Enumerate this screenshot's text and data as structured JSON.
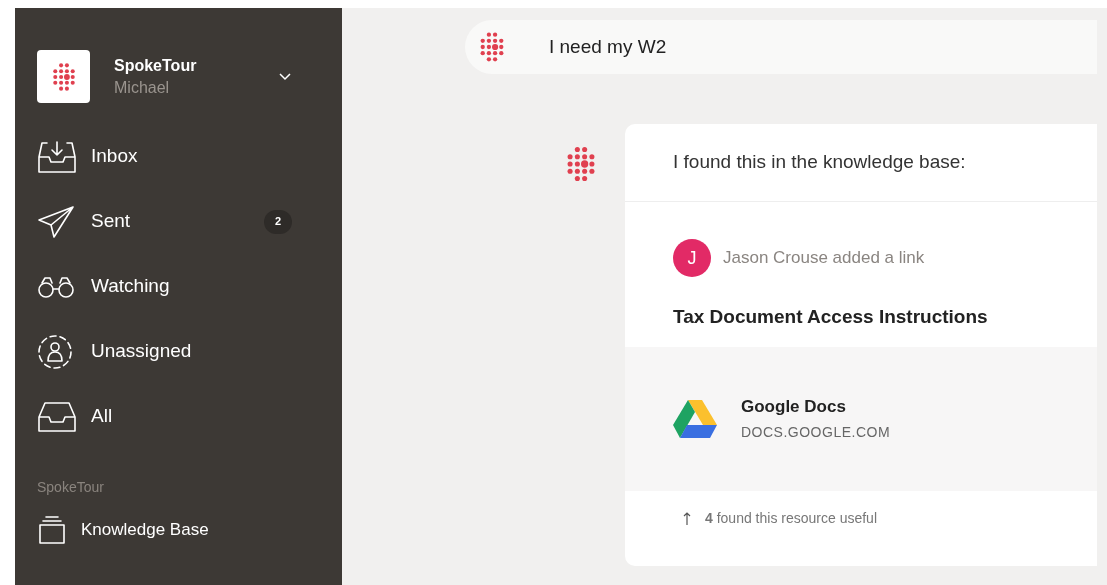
{
  "workspace": {
    "name": "SpokeTour",
    "user": "Michael"
  },
  "nav": [
    {
      "label": "Inbox",
      "kind": "inbox"
    },
    {
      "label": "Sent",
      "kind": "sent",
      "badge": "2"
    },
    {
      "label": "Watching",
      "kind": "watching"
    },
    {
      "label": "Unassigned",
      "kind": "unassigned"
    },
    {
      "label": "All",
      "kind": "all"
    }
  ],
  "section": {
    "title": "SpokeTour",
    "items": [
      {
        "label": "Knowledge Base",
        "kind": "knowledge"
      }
    ]
  },
  "query": "I need my W2",
  "answer": {
    "intro": "I found this in the knowledge base:",
    "author_initial": "J",
    "author_line": "Jason Crouse added a link",
    "title": "Tax Document Access Instructions",
    "link": {
      "name": "Google Docs",
      "domain": "DOCS.GOOGLE.COM"
    },
    "footer": "**4** found this resource useful"
  }
}
